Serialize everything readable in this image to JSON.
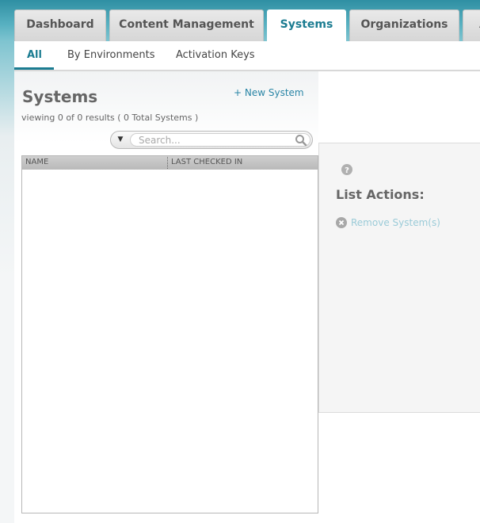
{
  "tabs": [
    {
      "label": "Dashboard"
    },
    {
      "label": "Content Management"
    },
    {
      "label": "Systems",
      "active": true
    },
    {
      "label": "Organizations"
    },
    {
      "label": "A"
    }
  ],
  "subnav": {
    "items": [
      {
        "label": "All",
        "active": true
      },
      {
        "label": "By Environments"
      },
      {
        "label": "Activation Keys"
      }
    ]
  },
  "page": {
    "title": "Systems",
    "new_link": "+ New System",
    "viewing": "viewing 0 of 0 results ( 0 Total Systems )"
  },
  "search": {
    "placeholder": "Search..."
  },
  "table": {
    "columns": [
      "NAME",
      "LAST CHECKED IN"
    ],
    "rows": []
  },
  "actions": {
    "title": "List Actions:",
    "remove_label": "Remove System(s)"
  },
  "icons": {
    "search": "search-icon",
    "dropdown": "chevron-down-icon",
    "help": "help-icon",
    "remove": "remove-icon"
  },
  "colors": {
    "accent": "#1b7c91",
    "link": "#2a86a6",
    "header_bg": "#3c9db0"
  }
}
